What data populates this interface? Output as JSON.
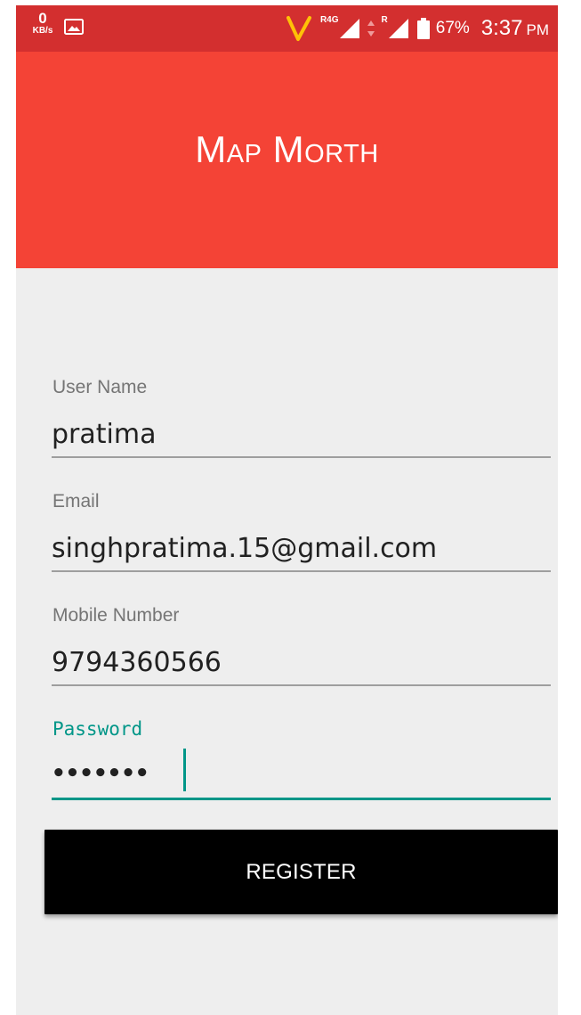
{
  "status_bar": {
    "speed_value": "0",
    "speed_unit": "KB/s",
    "network_label_1": "R4G",
    "network_label_2": "R",
    "battery_percent": "67%",
    "time": "3:37",
    "ampm": "PM",
    "icons": [
      "image-icon",
      "v-logo-icon",
      "signal-4g-icon",
      "data-arrows-icon",
      "signal-roaming-icon",
      "battery-icon"
    ]
  },
  "header": {
    "title": "Map Morth"
  },
  "form": {
    "fields": [
      {
        "label": "User Name",
        "value": "pratima"
      },
      {
        "label": "Email",
        "value": "singhpratima.15@gmail.com"
      },
      {
        "label": "Mobile Number",
        "value": "9794360566"
      },
      {
        "label": "Password",
        "value": "•••••••"
      }
    ],
    "submit_label": "REGISTER"
  },
  "colors": {
    "status_bar": "#d32f2f",
    "app_bar": "#f44336",
    "background": "#eeeeee",
    "accent": "#009688",
    "button": "#000000"
  }
}
